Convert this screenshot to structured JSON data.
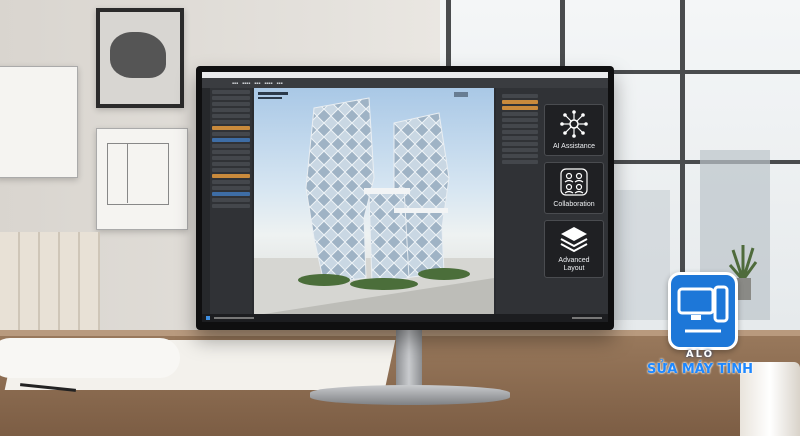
{
  "cards": [
    {
      "label": "AI Assistance",
      "icon": "network-icon"
    },
    {
      "label": "Collaboration",
      "icon": "people-icon"
    },
    {
      "label": "Advanced Layout",
      "icon": "layers-icon"
    }
  ],
  "watermark": {
    "line1": "ALO",
    "line2": "SỬA MÁY TÍNH"
  },
  "colors": {
    "brand_blue": "#1d77d8",
    "panel_dark": "#303236",
    "selection": "#3e6da5"
  }
}
